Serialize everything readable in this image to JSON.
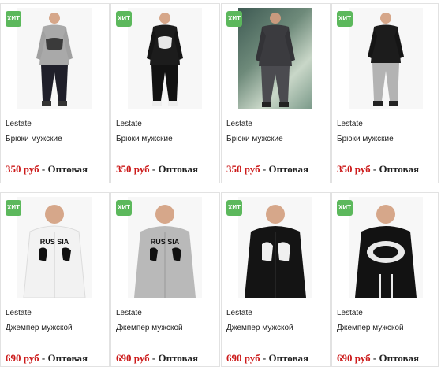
{
  "colors": {
    "badge": "#5cb85c",
    "price": "#cc1a1a",
    "border": "#e2e2e2"
  },
  "products": [
    {
      "badge": "ХИТ",
      "brand": "Lestate",
      "name": "Брюки мужские",
      "price": "350 руб",
      "separator": "-",
      "price_type": "Оптовая",
      "image": "man-grey-tracksuit"
    },
    {
      "badge": "ХИТ",
      "brand": "Lestate",
      "name": "Брюки мужские",
      "price": "350 руб",
      "separator": "-",
      "price_type": "Оптовая",
      "image": "man-black-tracksuit"
    },
    {
      "badge": "ХИТ",
      "brand": "Lestate",
      "name": "Брюки мужские",
      "price": "350 руб",
      "separator": "-",
      "price_type": "Оптовая",
      "image": "man-dark-grey-tracksuit-outdoor"
    },
    {
      "badge": "ХИТ",
      "brand": "Lestate",
      "name": "Брюки мужские",
      "price": "350 руб",
      "separator": "-",
      "price_type": "Оптовая",
      "image": "man-black-hoodie-grey-pants"
    },
    {
      "badge": "ХИТ",
      "brand": "Lestate",
      "name": "Джемпер мужской",
      "price": "690 руб",
      "separator": "-",
      "price_type": "Оптовая",
      "image": "man-white-russia-hoodie"
    },
    {
      "badge": "ХИТ",
      "brand": "Lestate",
      "name": "Джемпер мужской",
      "price": "690 руб",
      "separator": "-",
      "price_type": "Оптовая",
      "image": "man-grey-russia-hoodie"
    },
    {
      "badge": "ХИТ",
      "brand": "Lestate",
      "name": "Джемпер мужской",
      "price": "690 руб",
      "separator": "-",
      "price_type": "Оптовая",
      "image": "man-black-hoodie-white-print"
    },
    {
      "badge": "ХИТ",
      "brand": "Lestate",
      "name": "Джемпер мужской",
      "price": "690 руб",
      "separator": "-",
      "price_type": "Оптовая",
      "image": "man-black-hoodie-graphic-print"
    }
  ]
}
